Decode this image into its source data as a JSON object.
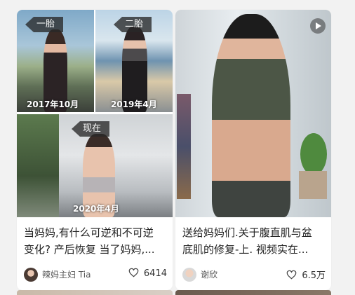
{
  "feed": {
    "cards": [
      {
        "collage_tags": [
          "一胎",
          "二胎",
          "现在"
        ],
        "collage_dates": [
          "2017年10月",
          "2019年4月",
          "2020年4月"
        ],
        "title_line1": "当妈妈,有什么可逆和不可逆",
        "title_line2": "变化? 产后恢复 当了妈妈,...",
        "author": "辣妈主妇 Tia",
        "likes": "6414",
        "has_video": false
      },
      {
        "title_line1": "送给妈妈们.关于腹直肌与盆",
        "title_line2": "底肌的修复-上. 视频实在...",
        "author": "谢欣",
        "likes": "6.5万",
        "has_video": true
      }
    ]
  },
  "colors": {
    "card_bg": "#ffffff",
    "page_bg": "#f2f2f2",
    "text_primary": "#222222",
    "text_secondary": "#555555"
  },
  "icons": {
    "like": "heart-outline-icon",
    "video": "play-icon"
  }
}
